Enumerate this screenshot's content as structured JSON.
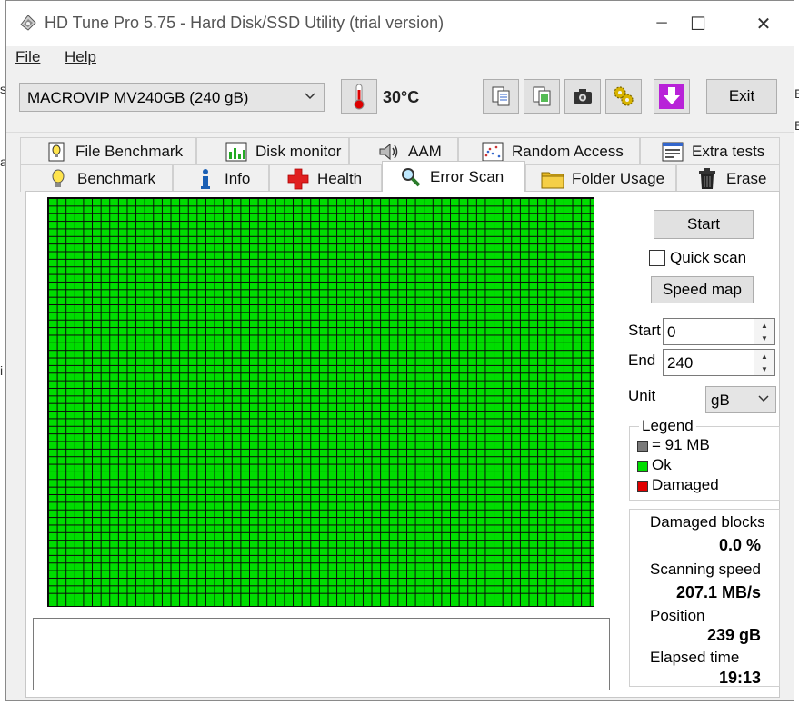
{
  "window": {
    "title": "HD Tune Pro 5.75 - Hard Disk/SSD Utility (trial version)",
    "minimize": "─",
    "maximize": "☐",
    "close": "✕"
  },
  "menu": {
    "file": "File",
    "help": "Help"
  },
  "toolbar": {
    "drive": "MACROVIP MV240GB (240 gB)",
    "temperature": "30°C",
    "exit_label": "Exit"
  },
  "tabs": {
    "row1": [
      {
        "label": "File Benchmark",
        "icon": "file-benchmark-icon"
      },
      {
        "label": "Disk monitor",
        "icon": "disk-monitor-icon"
      },
      {
        "label": "AAM",
        "icon": "speaker-icon"
      },
      {
        "label": "Random Access",
        "icon": "random-access-icon"
      },
      {
        "label": "Extra tests",
        "icon": "extra-tests-icon"
      }
    ],
    "row2": [
      {
        "label": "Benchmark",
        "icon": "lightbulb-icon"
      },
      {
        "label": "Info",
        "icon": "info-icon"
      },
      {
        "label": "Health",
        "icon": "health-cross-icon"
      },
      {
        "label": "Error Scan",
        "icon": "magnifier-icon",
        "active": true
      },
      {
        "label": "Folder Usage",
        "icon": "folder-icon"
      },
      {
        "label": "Erase",
        "icon": "trash-icon"
      }
    ]
  },
  "error_scan": {
    "start_button": "Start",
    "quick_scan_label": "Quick scan",
    "quick_scan_checked": false,
    "speed_map_button": "Speed map",
    "start_label": "Start",
    "start_value": "0",
    "end_label": "End",
    "end_value": "240",
    "unit_label": "Unit",
    "unit_value": "gB",
    "legend": {
      "title": "Legend",
      "block_size": "= 91 MB",
      "ok": "Ok",
      "damaged": "Damaged"
    },
    "stats": {
      "damaged_blocks_label": "Damaged blocks",
      "damaged_blocks_value": "0.0 %",
      "scanning_speed_label": "Scanning speed",
      "scanning_speed_value": "207.1 MB/s",
      "position_label": "Position",
      "position_value": "239 gB",
      "elapsed_label": "Elapsed time",
      "elapsed_value": "19:13"
    },
    "colors": {
      "ok": "#00dd00",
      "damaged": "#e00000",
      "block": "#7a7a7a"
    },
    "scan_status": "all blocks ok"
  }
}
